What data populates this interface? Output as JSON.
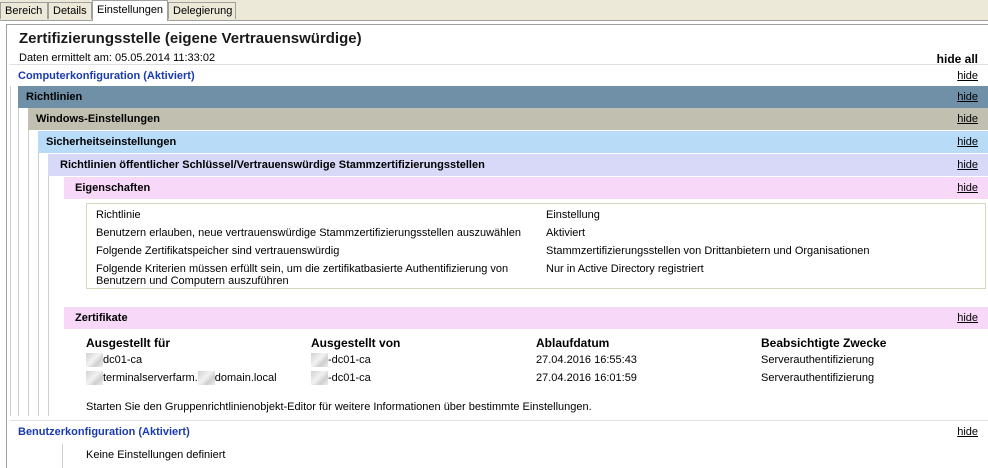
{
  "tabs": [
    {
      "label": "Bereich"
    },
    {
      "label": "Details"
    },
    {
      "label": "Einstellungen"
    },
    {
      "label": "Delegierung"
    }
  ],
  "report": {
    "title": "Zertifizierungsstelle (eigene Vertrauenswürdige)",
    "date": "Daten ermittelt am: 05.05.2014 11:33:02",
    "hide_all": "hide all",
    "hide": "hide"
  },
  "sections": {
    "computer": "Computerkonfiguration (Aktiviert)",
    "policies": "Richtlinien",
    "windows": "Windows-Einstellungen",
    "security": "Sicherheitseinstellungen",
    "pki": "Richtlinien öffentlicher Schlüssel/Vertrauenswürdige Stammzertifizierungsstellen",
    "properties": "Eigenschaften",
    "certificates": "Zertifikate",
    "user": "Benutzerkonfiguration (Aktiviert)"
  },
  "properties_table": {
    "headers": [
      "Richtlinie",
      "Einstellung"
    ],
    "rows": [
      [
        "Benutzern erlauben, neue vertrauenswürdige Stammzertifizierungsstellen auszuwählen",
        "Aktiviert"
      ],
      [
        "Folgende Zertifikatspeicher sind vertrauenswürdig",
        "Stammzertifizierungsstellen von Drittanbietern und Organisationen"
      ],
      [
        "Folgende Kriterien müssen erfüllt sein, um die zertifikatbasierte Authentifizierung von Benutzern und Computern auszuführen",
        "Nur in Active Directory registriert"
      ]
    ]
  },
  "certificates_table": {
    "headers": [
      "Ausgestellt für",
      "Ausgestellt von",
      "Ablaufdatum",
      "Beabsichtigte Zwecke"
    ],
    "rows": [
      {
        "issued_to": "dc01-ca",
        "issued_by": "-dc01-ca",
        "expires": "27.04.2016 16:55:43",
        "purpose": "Serverauthentifizierung"
      },
      {
        "issued_to_a": "terminalserverfarm.",
        "issued_to_b": "domain.local",
        "issued_by": "-dc01-ca",
        "expires": "27.04.2016 16:01:59",
        "purpose": "Serverauthentifizierung"
      }
    ],
    "note": "Starten Sie den Gruppenrichtlinienobjekt-Editor für weitere Informationen über bestimmte Einstellungen."
  },
  "user_config": {
    "empty": "Keine Einstellungen definiert"
  },
  "colors": {
    "policies": "#7090a8",
    "windows": "#c0bfb0",
    "security": "#b8dcf8",
    "pki": "#d8d8f8",
    "pink": "#f8d8f8"
  }
}
